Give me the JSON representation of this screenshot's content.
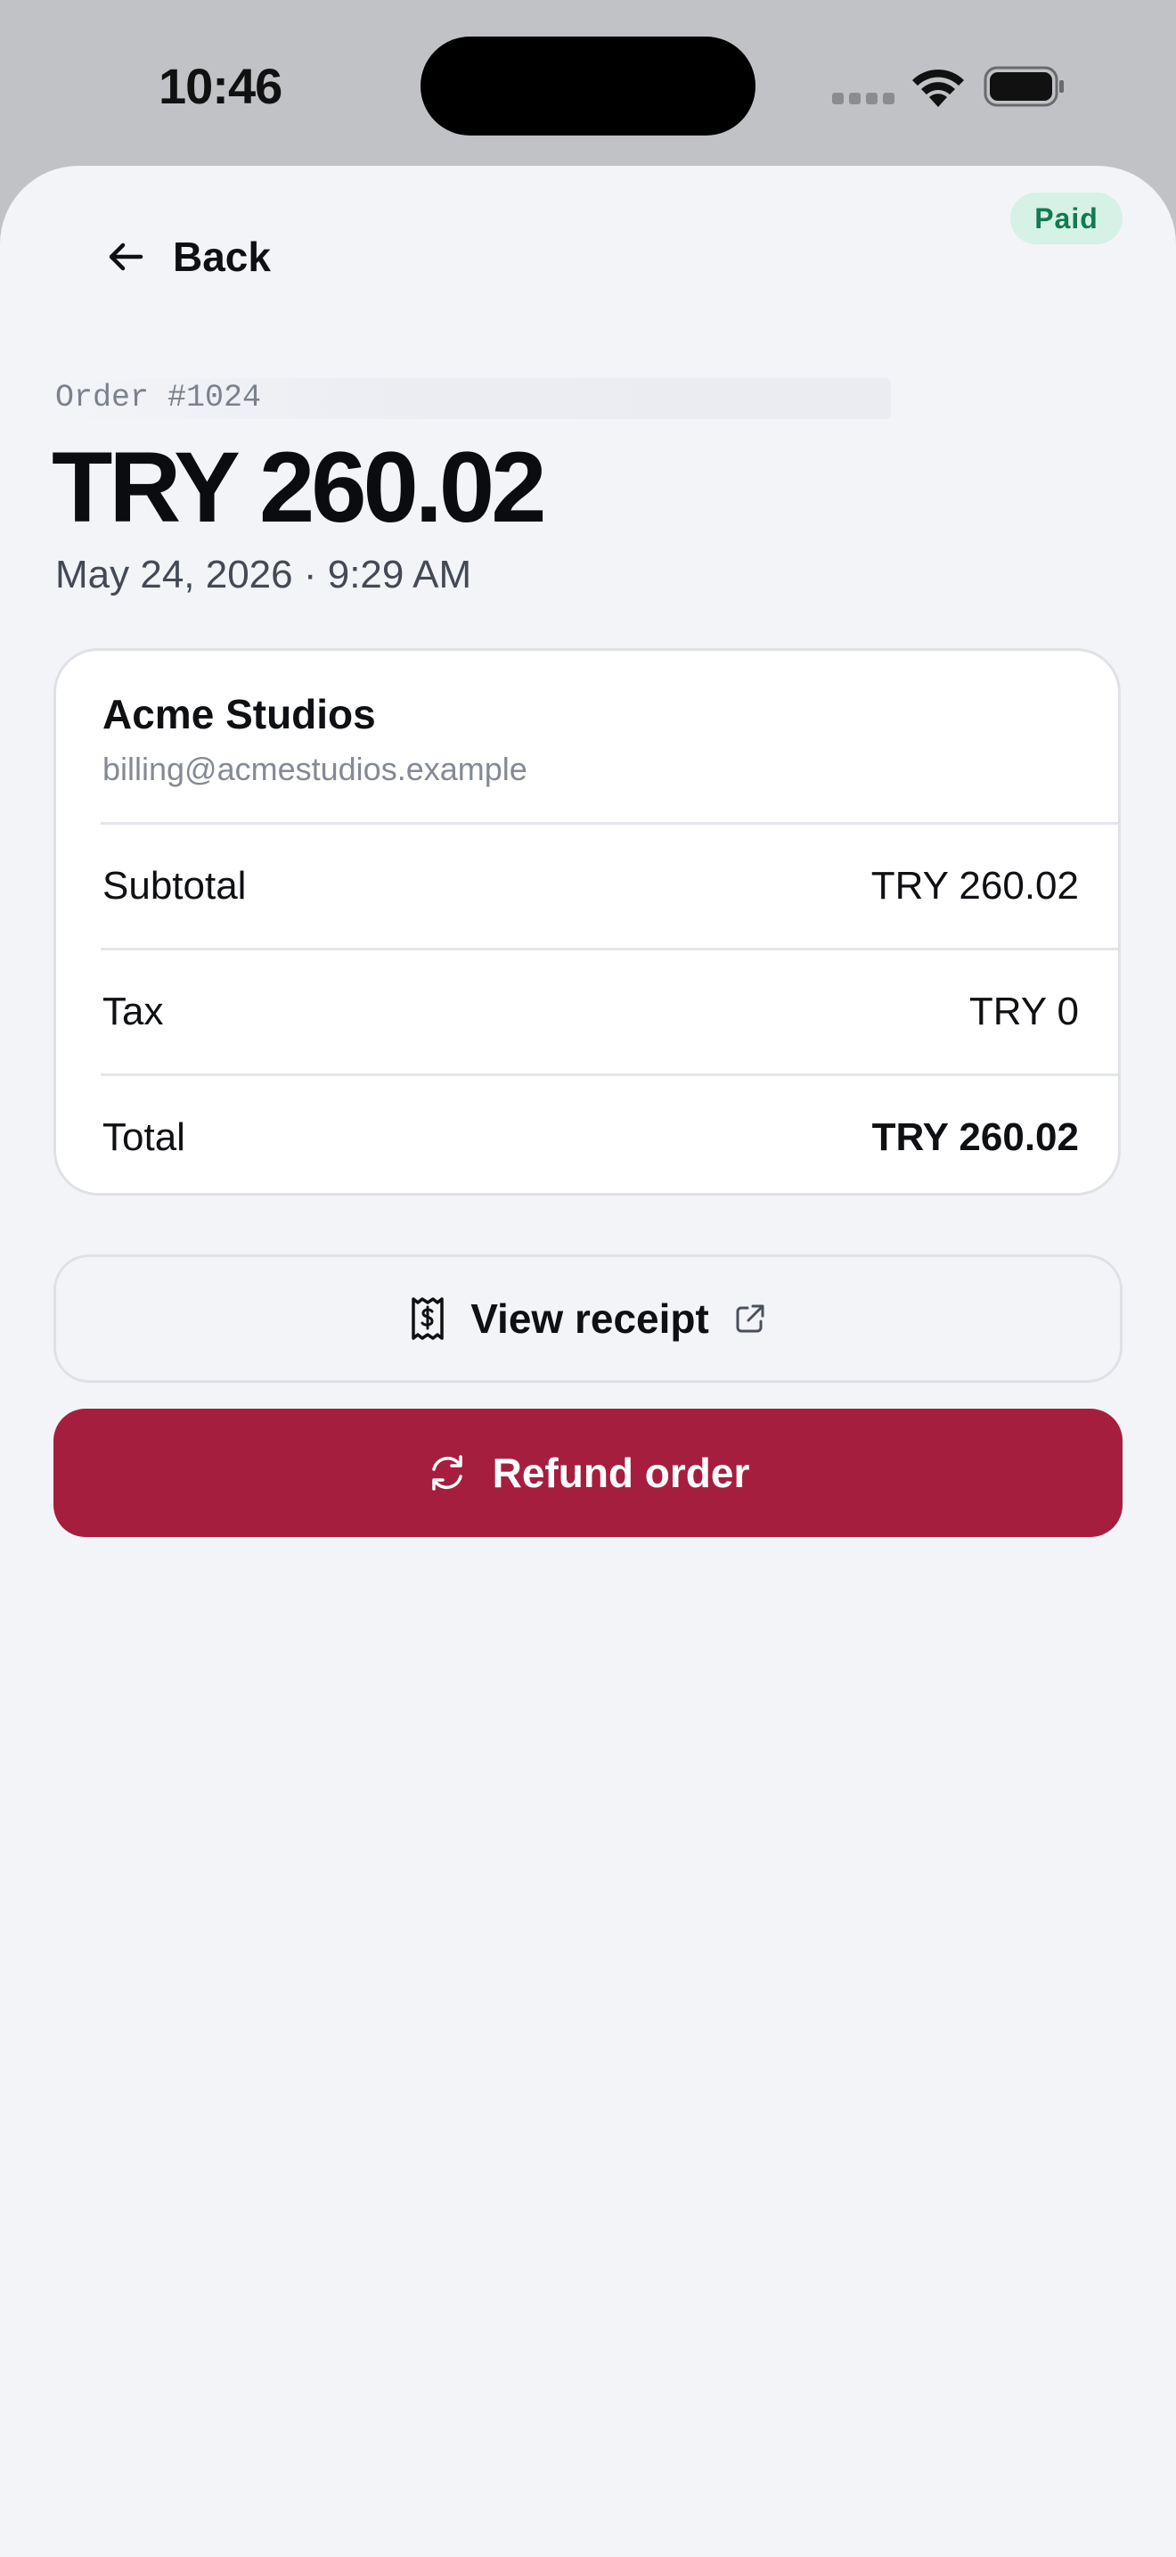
{
  "status_bar": {
    "time": "10:46"
  },
  "header": {
    "back_label": "Back",
    "status_badge": "Paid"
  },
  "order": {
    "id": "Order #1024",
    "amount": "TRY 260.02",
    "datetime": "May 24, 2026 · 9:29 AM"
  },
  "customer": {
    "name": "Acme Studios",
    "email": "billing@acmestudios.example"
  },
  "summary": [
    {
      "label": "Subtotal",
      "value": "TRY 260.02"
    },
    {
      "label": "Tax",
      "value": "TRY 0"
    },
    {
      "label": "Total",
      "value": "TRY 260.02"
    }
  ],
  "actions": {
    "view_receipt": "View receipt",
    "refund": "Refund order"
  },
  "colors": {
    "accent_refund": "#a61e3e",
    "paid_badge_bg": "#d6f1e5",
    "paid_badge_text": "#127a52",
    "background": "#f3f4f8"
  },
  "icons": {
    "back": "arrow-left-icon",
    "receipt": "receipt-icon",
    "external": "external-link-icon",
    "refund": "refresh-icon"
  }
}
